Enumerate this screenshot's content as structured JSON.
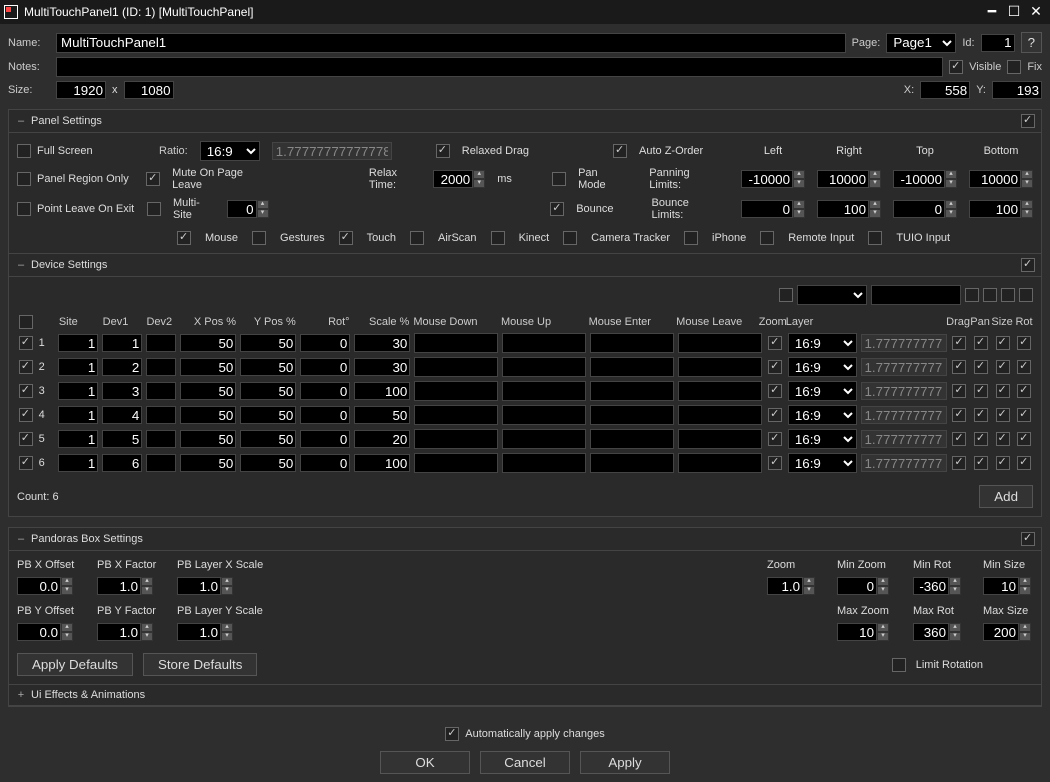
{
  "window": {
    "title": "MultiTouchPanel1 (ID: 1) [MultiTouchPanel]"
  },
  "header": {
    "name_label": "Name:",
    "name_value": "MultiTouchPanel1",
    "page_label": "Page:",
    "page_value": "Page1",
    "id_label": "Id:",
    "id_value": "1",
    "help_label": "?",
    "notes_label": "Notes:",
    "notes_value": "",
    "visible_label": "Visible",
    "visible_checked": true,
    "fix_label": "Fix",
    "fix_checked": false,
    "size_label": "Size:",
    "size_w": "1920",
    "size_h": "1080",
    "x_label": "X:",
    "x_val": "558",
    "y_label": "Y:",
    "y_val": "193"
  },
  "panel_settings": {
    "title": "Panel Settings",
    "full_screen": "Full Screen",
    "ratio_label": "Ratio:",
    "ratio_sel": "16:9",
    "ratio_val": "1.77777777777778",
    "relaxed_drag": "Relaxed Drag",
    "auto_z": "Auto Z-Order",
    "left": "Left",
    "right": "Right",
    "top": "Top",
    "btm": "Bottom",
    "panel_region": "Panel Region Only",
    "mute_leave": "Mute On Page Leave",
    "relax_time_label": "Relax Time:",
    "relax_time_val": "2000",
    "relax_ms": "ms",
    "pan_mode": "Pan Mode",
    "pan_limits": "Panning Limits:",
    "pan_left": "-10000",
    "pan_right": "10000",
    "pan_top": "-10000",
    "pan_bottom": "10000",
    "point_leave": "Point Leave On Exit",
    "multi_site": "Multi-Site",
    "multi_site_val": "0",
    "bounce": "Bounce",
    "bounce_limits": "Bounce Limits:",
    "bounce_left": "0",
    "bounce_right": "100",
    "bounce_top": "0",
    "bounce_bottom": "100",
    "inputs": {
      "mouse": "Mouse",
      "gestures": "Gestures",
      "touch": "Touch",
      "airscan": "AirScan",
      "kinect": "Kinect",
      "camera": "Camera Tracker",
      "iphone": "iPhone",
      "remote": "Remote Input",
      "tuio": "TUIO Input"
    }
  },
  "device_settings": {
    "title": "Device Settings",
    "cols": {
      "site": "Site",
      "dev1": "Dev1",
      "dev2": "Dev2",
      "xpos": "X Pos %",
      "ypos": "Y Pos %",
      "rot": "Rot°",
      "scale": "Scale %",
      "mdown": "Mouse Down",
      "mup": "Mouse Up",
      "menter": "Mouse Enter",
      "mleave": "Mouse Leave",
      "zoom": "Zoom",
      "layer": "Layer",
      "drag": "Drag",
      "pan": "Pan",
      "size": "Size",
      "rotc": "Rot"
    },
    "rows": [
      {
        "idx": "1",
        "site": "1",
        "dev1": "1",
        "dev2": "",
        "xp": "50",
        "yp": "50",
        "rot": "0",
        "scale": "30",
        "layer": "16:9",
        "extra": "1.77777777777"
      },
      {
        "idx": "2",
        "site": "1",
        "dev1": "2",
        "dev2": "",
        "xp": "50",
        "yp": "50",
        "rot": "0",
        "scale": "30",
        "layer": "16:9",
        "extra": "1.77777777777"
      },
      {
        "idx": "3",
        "site": "1",
        "dev1": "3",
        "dev2": "",
        "xp": "50",
        "yp": "50",
        "rot": "0",
        "scale": "100",
        "layer": "16:9",
        "extra": "1.77777777777"
      },
      {
        "idx": "4",
        "site": "1",
        "dev1": "4",
        "dev2": "",
        "xp": "50",
        "yp": "50",
        "rot": "0",
        "scale": "50",
        "layer": "16:9",
        "extra": "1.77777777777"
      },
      {
        "idx": "5",
        "site": "1",
        "dev1": "5",
        "dev2": "",
        "xp": "50",
        "yp": "50",
        "rot": "0",
        "scale": "20",
        "layer": "16:9",
        "extra": "1.77777777777"
      },
      {
        "idx": "6",
        "site": "1",
        "dev1": "6",
        "dev2": "",
        "xp": "50",
        "yp": "50",
        "rot": "0",
        "scale": "100",
        "layer": "16:9",
        "extra": "1.77777777777"
      }
    ],
    "count_label": "Count: 6",
    "add_btn": "Add"
  },
  "pb_settings": {
    "title": "Pandoras Box Settings",
    "pbx_off": "PB X Offset",
    "pbx_off_v": "0.0",
    "pbx_fac": "PB X Factor",
    "pbx_fac_v": "1.0",
    "pbl_x": "PB Layer X Scale",
    "pbl_x_v": "1.0",
    "zoom": "Zoom",
    "zoom_v": "1.0",
    "min_zoom": "Min Zoom",
    "min_zoom_v": "0",
    "min_rot": "Min Rot",
    "min_rot_v": "-360",
    "min_size": "Min Size",
    "min_size_v": "10",
    "pby_off": "PB Y Offset",
    "pby_off_v": "0.0",
    "pby_fac": "PB Y Factor",
    "pby_fac_v": "1.0",
    "pbl_y": "PB Layer Y Scale",
    "pbl_y_v": "1.0",
    "max_zoom": "Max Zoom",
    "max_zoom_v": "10",
    "max_rot": "Max Rot",
    "max_rot_v": "360",
    "max_size": "Max Size",
    "max_size_v": "200",
    "apply_def": "Apply Defaults",
    "store_def": "Store Defaults",
    "limit_rot": "Limit Rotation"
  },
  "ui_effects": {
    "title": "Ui Effects & Animations"
  },
  "footer": {
    "auto_apply": "Automatically apply changes",
    "ok": "OK",
    "cancel": "Cancel",
    "apply": "Apply"
  }
}
